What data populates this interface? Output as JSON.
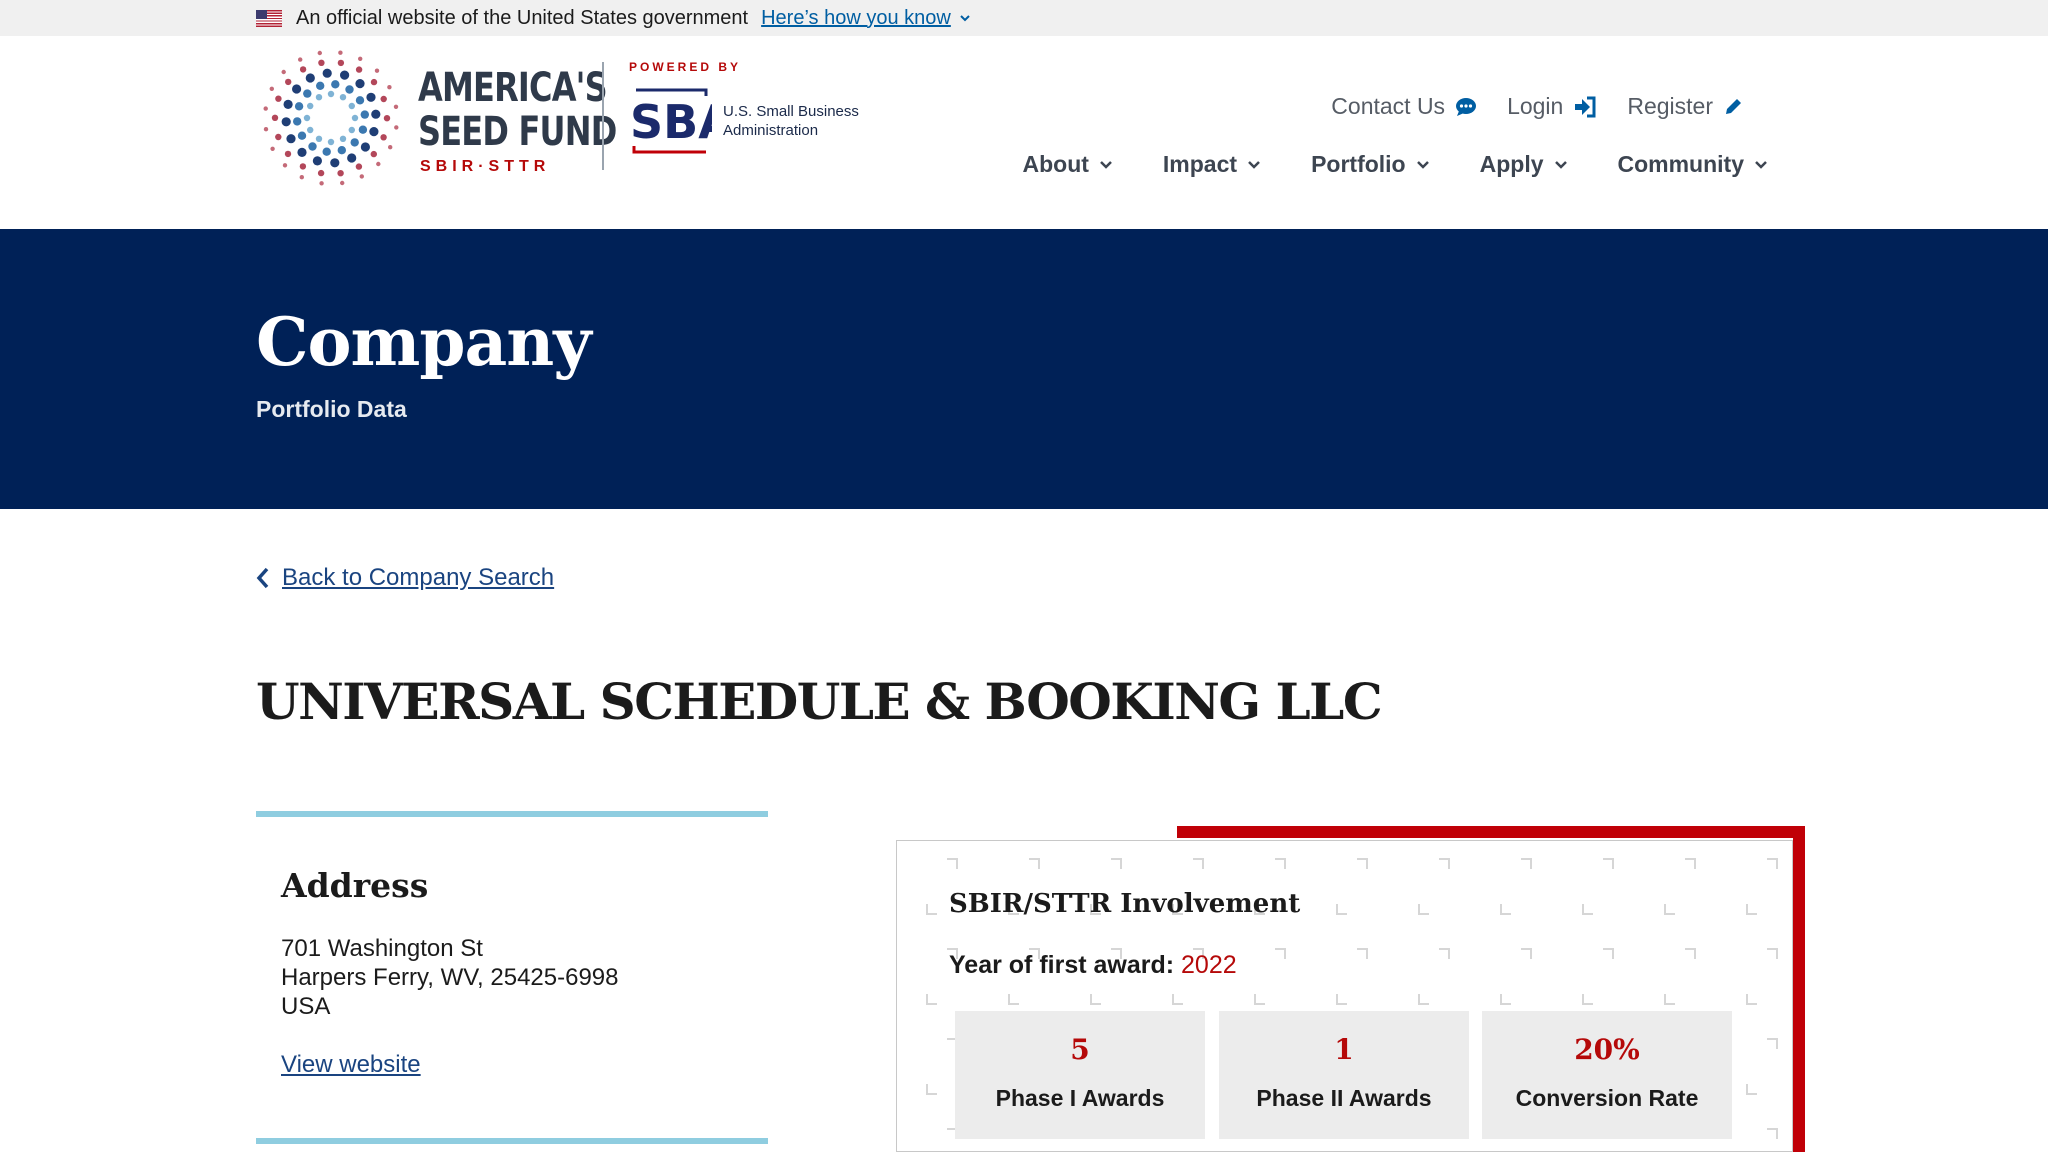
{
  "gov_banner": {
    "text": "An official website of the United States government",
    "link": "Here’s how you know"
  },
  "logo": {
    "line1": "AMERICA'S",
    "line2": "SEED FUND",
    "sub": "SBIR·STTR",
    "powered_by": "POWERED BY",
    "sba_line1": "U.S. Small Business",
    "sba_line2": "Administration"
  },
  "utility_nav": {
    "contact": "Contact Us",
    "login": "Login",
    "register": "Register"
  },
  "main_nav": [
    "About",
    "Impact",
    "Portfolio",
    "Apply",
    "Community"
  ],
  "hero": {
    "title": "Company",
    "subtitle": "Portfolio Data"
  },
  "back_link": "Back to Company Search",
  "company_name": "UNIVERSAL SCHEDULE & BOOKING LLC",
  "address": {
    "heading": "Address",
    "street": "701 Washington St",
    "city_line": "Harpers Ferry, WV, 25425-6998",
    "country": "USA",
    "website_link": "View website"
  },
  "involvement": {
    "heading": "SBIR/STTR Involvement",
    "year_label": "Year of first award:",
    "year_value": "2022",
    "stats": [
      {
        "value": "5",
        "label": "Phase I Awards"
      },
      {
        "value": "1",
        "label": "Phase II Awards"
      },
      {
        "value": "20%",
        "label": "Conversion Rate"
      }
    ]
  },
  "colors": {
    "navy": "#002157",
    "accent_red": "#b50909",
    "link_blue": "#1a4480",
    "light_blue_rule": "#8fcde0"
  }
}
